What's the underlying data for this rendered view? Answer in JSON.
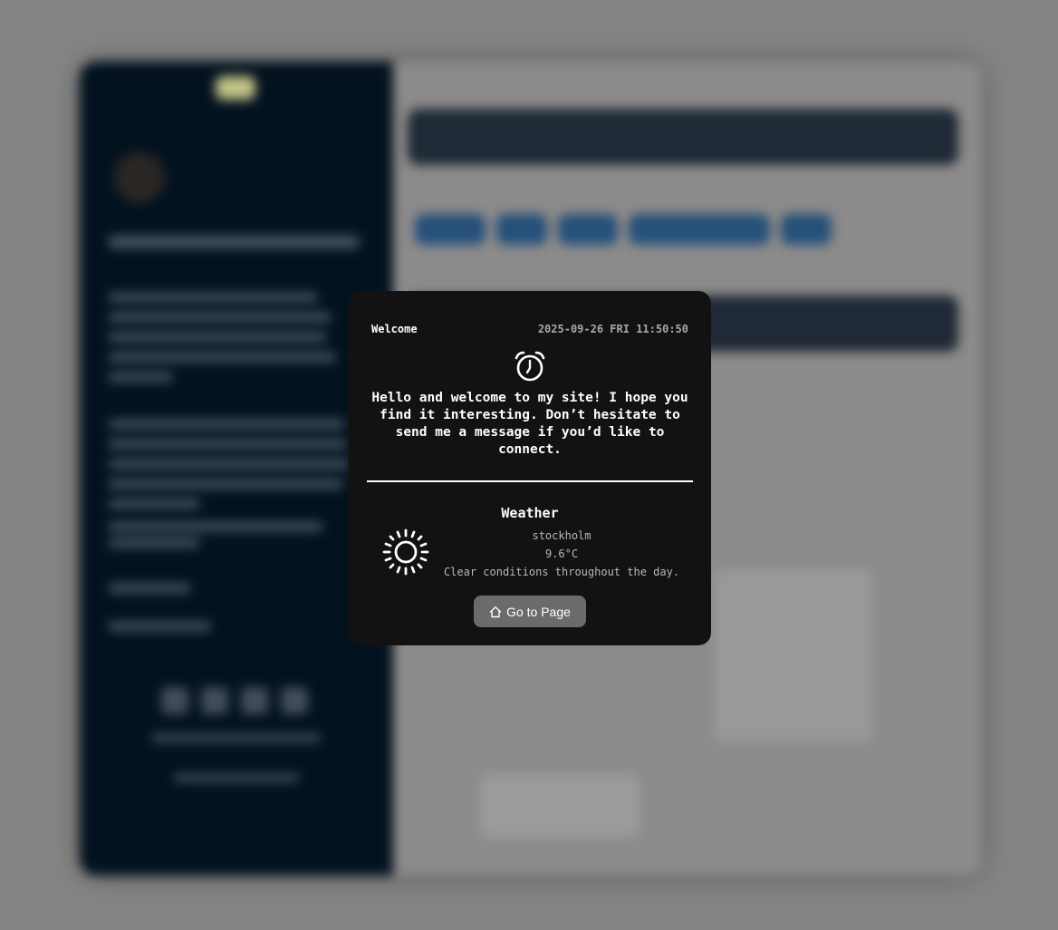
{
  "modal": {
    "title": "Welcome",
    "datetime": "2025-09-26 FRI 11:50:50",
    "alarm_icon": "alarm-clock-icon",
    "message": "Hello and welcome to my site! I hope you find it interesting. Don’t hesitate to send me a message if you’d like to connect.",
    "weather": {
      "title": "Weather",
      "icon": "sun-icon",
      "city": "stockholm",
      "temperature": "9.6°C",
      "description": "Clear conditions throughout the day."
    },
    "button": {
      "icon": "home-icon",
      "label": "Go to Page"
    }
  },
  "colors": {
    "overlay": "#858585",
    "modal_bg": "#121212",
    "sidebar_bg": "#03121f",
    "button_bg": "#6b6b6b"
  }
}
